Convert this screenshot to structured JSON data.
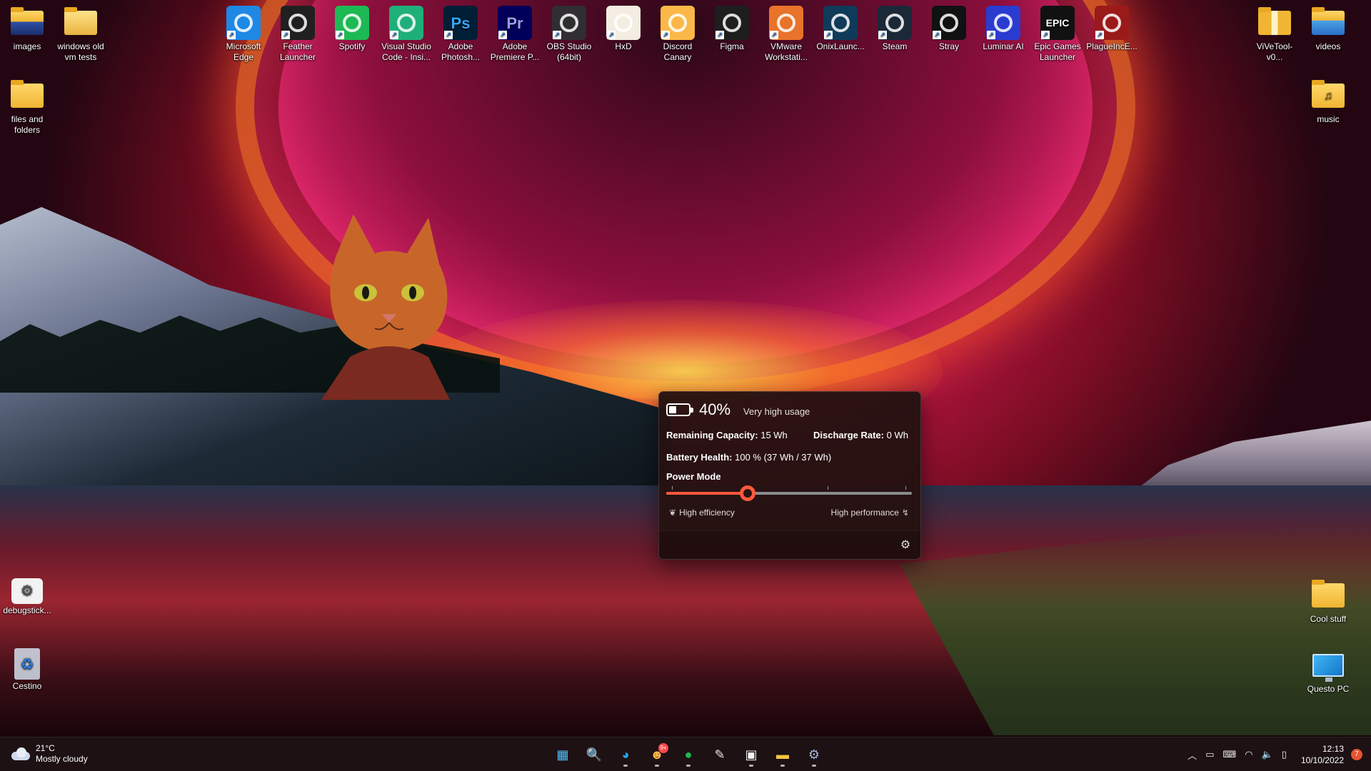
{
  "desktop_icons_left": [
    {
      "label": "images",
      "icon": "image-folder-icon",
      "type": "folder"
    },
    {
      "label": "windows old vm tests",
      "icon": "folder-icon",
      "type": "folder"
    },
    {
      "label": "files and folders",
      "icon": "folder-icon",
      "type": "folder"
    },
    {
      "label": "debugstick...",
      "icon": "settings-file-icon",
      "type": "file"
    },
    {
      "label": "Cestino",
      "icon": "recycle-bin-icon",
      "type": "system"
    }
  ],
  "desktop_icons_top": [
    {
      "label": "Microsoft Edge",
      "icon": "edge-icon",
      "color": "#1e88e5"
    },
    {
      "label": "Feather Launcher",
      "icon": "feather-icon",
      "color": "#202020"
    },
    {
      "label": "Spotify",
      "icon": "spotify-icon",
      "color": "#1db954"
    },
    {
      "label": "Visual Studio Code - Insi...",
      "icon": "vscode-insiders-icon",
      "color": "#1fb07a"
    },
    {
      "label": "Adobe Photosh...",
      "icon": "photoshop-icon",
      "color": "#001e36",
      "text": "Ps",
      "text_color": "#31a8ff"
    },
    {
      "label": "Adobe Premiere P...",
      "icon": "premiere-icon",
      "color": "#00005b",
      "text": "Pr",
      "text_color": "#9999ff"
    },
    {
      "label": "OBS Studio (64bit)",
      "icon": "obs-icon",
      "color": "#302e31"
    },
    {
      "label": "HxD",
      "icon": "hxd-icon",
      "color": "#f4ede2"
    },
    {
      "label": "Discord Canary",
      "icon": "discord-canary-icon",
      "color": "#fbb848"
    },
    {
      "label": "Figma",
      "icon": "figma-icon",
      "color": "#1e1e1e"
    },
    {
      "label": "VMware Workstati...",
      "icon": "vmware-icon",
      "color": "#e8732a"
    },
    {
      "label": "OnixLaunc...",
      "icon": "onix-icon",
      "color": "#0f3a5a"
    },
    {
      "label": "Steam",
      "icon": "steam-icon",
      "color": "#1b2838"
    },
    {
      "label": "Stray",
      "icon": "stray-icon",
      "color": "#111111"
    },
    {
      "label": "Luminar AI",
      "icon": "luminar-icon",
      "color": "#2a3bd0"
    },
    {
      "label": "Epic Games Launcher",
      "icon": "epic-games-icon",
      "color": "#111111",
      "text": "EPIC"
    },
    {
      "label": "PlagueIncE...",
      "icon": "plague-inc-icon",
      "color": "#9a1a1a"
    }
  ],
  "desktop_icons_right": [
    {
      "label": "ViVeTool-v0...",
      "icon": "zip-folder-icon"
    },
    {
      "label": "videos",
      "icon": "video-folder-icon"
    },
    {
      "label": "music",
      "icon": "music-folder-icon"
    },
    {
      "label": "Cool stuff",
      "icon": "folder-icon"
    },
    {
      "label": "Questo PC",
      "icon": "computer-icon"
    }
  ],
  "battery": {
    "percent_label": "40%",
    "percent": 40,
    "usage_label": "Very high usage",
    "remaining_label": "Remaining Capacity:",
    "remaining_value": "15 Wh",
    "discharge_label": "Discharge Rate:",
    "discharge_value": "0 Wh",
    "health_label": "Battery Health:",
    "health_value": "100 % (37 Wh / 37 Wh)",
    "power_mode_label": "Power Mode",
    "power_mode_level": 0.33,
    "left_label": "High efficiency",
    "right_label": "High performance",
    "accent": "#ff5a3a"
  },
  "taskbar": {
    "weather_temp": "21°C",
    "weather_desc": "Mostly cloudy",
    "apps": [
      {
        "name": "start-button",
        "icon": "windows-icon",
        "glyph": "▦",
        "color": "#4cc2ff",
        "running": false
      },
      {
        "name": "search-button",
        "icon": "search-icon",
        "glyph": "🔍",
        "color": "#8ec7ff",
        "running": false
      },
      {
        "name": "edge-taskbar",
        "icon": "edge-icon",
        "glyph": "◕",
        "color": "#22a6e8",
        "running": true
      },
      {
        "name": "discord-taskbar",
        "icon": "discord-icon",
        "glyph": "☻",
        "color": "#fbb848",
        "running": true,
        "badge": "9+"
      },
      {
        "name": "spotify-taskbar",
        "icon": "spotify-icon",
        "glyph": "●",
        "color": "#1db954",
        "running": true
      },
      {
        "name": "feather-taskbar",
        "icon": "feather-icon",
        "glyph": "✎",
        "color": "#e6e6e6",
        "running": false
      },
      {
        "name": "store-taskbar",
        "icon": "store-icon",
        "glyph": "▣",
        "color": "#f5f5f5",
        "running": true
      },
      {
        "name": "explorer-taskbar",
        "icon": "file-explorer-icon",
        "glyph": "▬",
        "color": "#f5c542",
        "running": true
      },
      {
        "name": "settings-taskbar",
        "icon": "settings-icon",
        "glyph": "⚙",
        "color": "#9fb7d8",
        "running": true
      }
    ],
    "time": "12:13",
    "date": "10/10/2022",
    "notification_count": "7"
  }
}
